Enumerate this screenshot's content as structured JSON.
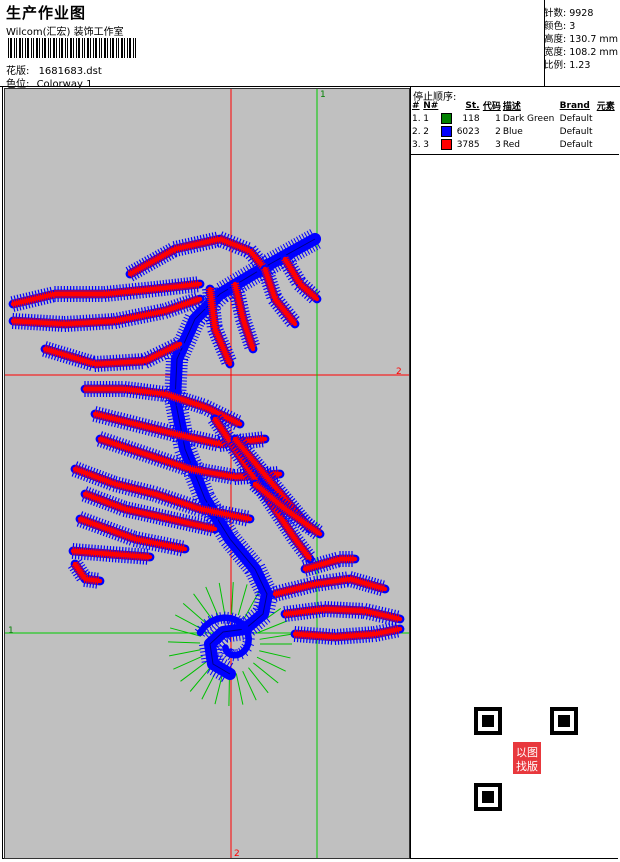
{
  "header": {
    "title": "生产作业图",
    "company": "Wilcom(汇宏) 装饰工作室",
    "design_label": "花版:",
    "design_value": "1681683.dst",
    "color_label": "色位:",
    "color_value": "Colorway 1"
  },
  "stats": {
    "stitches": "针数: 9928",
    "colors": "颜色: 3",
    "height": "高度: 130.7 mm",
    "width": "宽度: 108.2 mm",
    "scale": "比例: 1.23"
  },
  "guides": {
    "top_mark": "1",
    "right_mark": "2",
    "left_mark": "1",
    "bottom_mark": "2"
  },
  "sequence": {
    "title": "停止顺序:",
    "headers": [
      "#",
      "N#",
      "St.",
      "代码",
      "描述",
      "Brand",
      "元素"
    ],
    "rows": [
      {
        "idx": "1.",
        "n": "1",
        "color": "#008000",
        "st": "118",
        "code": "1",
        "desc": "Dark Green",
        "brand": "Default"
      },
      {
        "idx": "2.",
        "n": "2",
        "color": "#0000ff",
        "st": "6023",
        "code": "2",
        "desc": "Blue",
        "brand": "Default"
      },
      {
        "idx": "3.",
        "n": "3",
        "color": "#ff0000",
        "st": "3785",
        "code": "3",
        "desc": "Red",
        "brand": "Default"
      }
    ]
  },
  "stamp": {
    "line1": "以图",
    "line2": "找版"
  },
  "colors": {
    "red": "#ff0000",
    "blue": "#0000ff",
    "green": "#00c000",
    "canvas": "#c0c0c0"
  }
}
